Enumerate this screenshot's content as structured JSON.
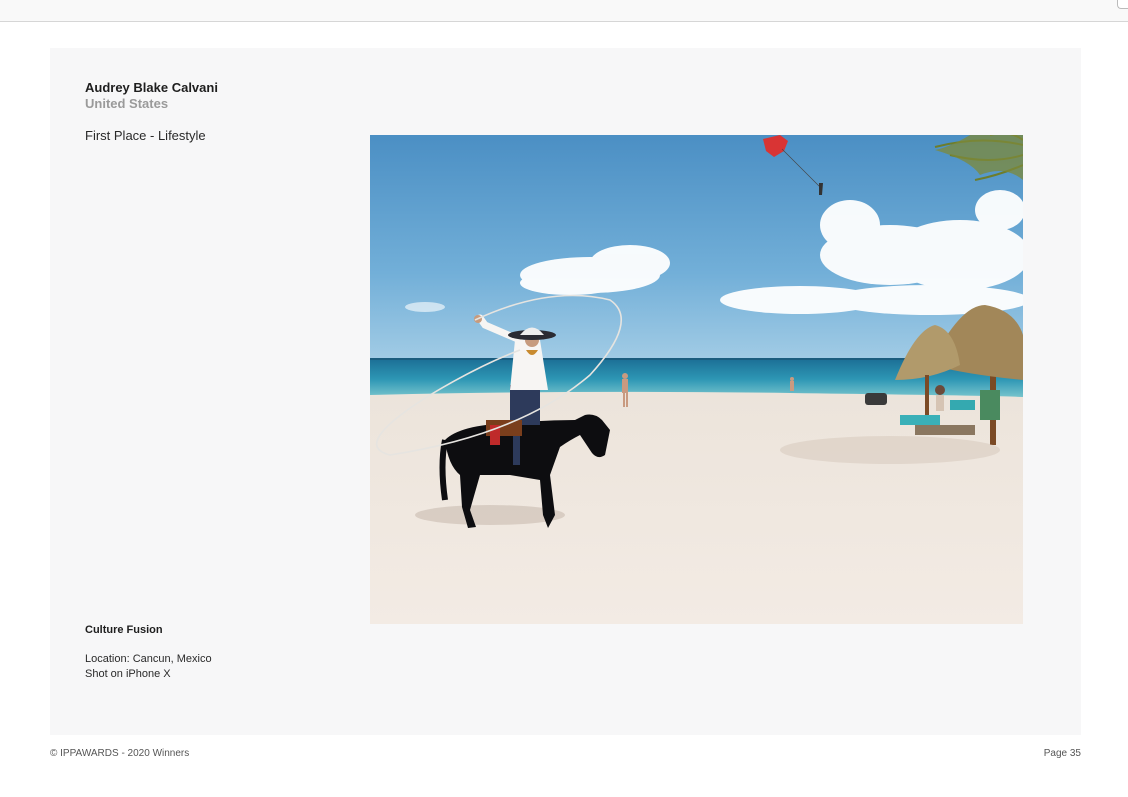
{
  "entry": {
    "author_name": "Audrey Blake Calvani",
    "country": "United States",
    "award": "First Place - Lifestyle",
    "photo_title": "Culture Fusion",
    "location": "Location: Cancun, Mexico",
    "device": "Shot on iPhone X"
  },
  "footer": {
    "copyright": "© IPPAWARDS - 2020 Winners",
    "page": "Page 35"
  },
  "colors": {
    "panel_background": "#f7f7f8",
    "sky": "#5a9ccc",
    "sea": "#2e8fb0",
    "sand": "#f1e9e2"
  }
}
